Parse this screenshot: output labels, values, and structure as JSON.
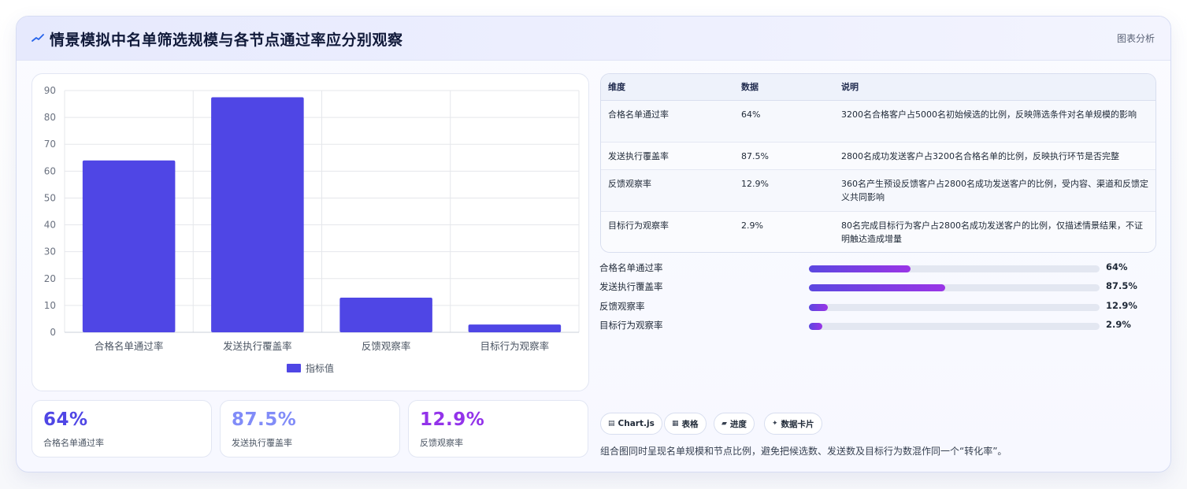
{
  "header": {
    "icon": "trend-line-icon",
    "title": "情景模拟中名单筛选规模与各节点通过率应分别观察",
    "tag": "图表分析"
  },
  "chart_data": {
    "type": "bar",
    "categories": [
      "合格名单通过率",
      "发送执行覆盖率",
      "反馈观察率",
      "目标行为观察率"
    ],
    "series": [
      {
        "name": "指标值",
        "values": [
          64,
          87.5,
          12.9,
          2.9
        ]
      }
    ],
    "ylim": [
      0,
      90
    ],
    "yticks": [
      0,
      10,
      20,
      30,
      40,
      50,
      60,
      70,
      80,
      90
    ],
    "grid": true,
    "legend": "bottom",
    "bar_color": "#4f46e5"
  },
  "kpis": [
    {
      "value": "64%",
      "label": "合格名单通过率",
      "color": "#4f46e5"
    },
    {
      "value": "87.5%",
      "label": "发送执行覆盖率",
      "color": "#818cf8"
    },
    {
      "value": "12.9%",
      "label": "反馈观察率",
      "color": "#9333ea"
    }
  ],
  "table": {
    "headers": [
      "维度",
      "数据",
      "说明"
    ],
    "rows": [
      {
        "dim": "合格名单通过率",
        "data": "64%",
        "desc": "3200名合格客户占5000名初始候选的比例，反映筛选条件对名单规模的影响"
      },
      {
        "dim": "发送执行覆盖率",
        "data": "87.5%",
        "desc": "2800名成功发送客户占3200名合格名单的比例，反映执行环节是否完整"
      },
      {
        "dim": "反馈观察率",
        "data": "12.9%",
        "desc": "360名产生预设反馈客户占2800名成功发送客户的比例，受内容、渠道和反馈定义共同影响"
      },
      {
        "dim": "目标行为观察率",
        "data": "2.9%",
        "desc": "80名完成目标行为客户占2800名成功发送客户的比例，仅描述情景结果，不证明触达造成增量"
      }
    ]
  },
  "progress": [
    {
      "label": "合格名单通过率",
      "value_text": "64%",
      "fraction": 0.35
    },
    {
      "label": "发送执行覆盖率",
      "value_text": "87.5%",
      "fraction": 0.47
    },
    {
      "label": "反馈观察率",
      "value_text": "12.9%",
      "fraction": 0.065
    },
    {
      "label": "目标行为观察率",
      "value_text": "2.9%",
      "fraction": 0.045
    }
  ],
  "chips": [
    {
      "icon": "chart-icon",
      "glyph": "▤",
      "label": "Chart.js"
    },
    {
      "icon": "table-icon",
      "glyph": "▦",
      "label": "表格"
    },
    {
      "icon": "progress-icon",
      "glyph": "▰",
      "label": "进度"
    },
    {
      "icon": "card-icon",
      "glyph": "✦",
      "label": "数据卡片"
    }
  ],
  "footnote": "组合图同时呈现名单规模和节点比例，避免把候选数、发送数及目标行为数混作同一个“转化率”。"
}
